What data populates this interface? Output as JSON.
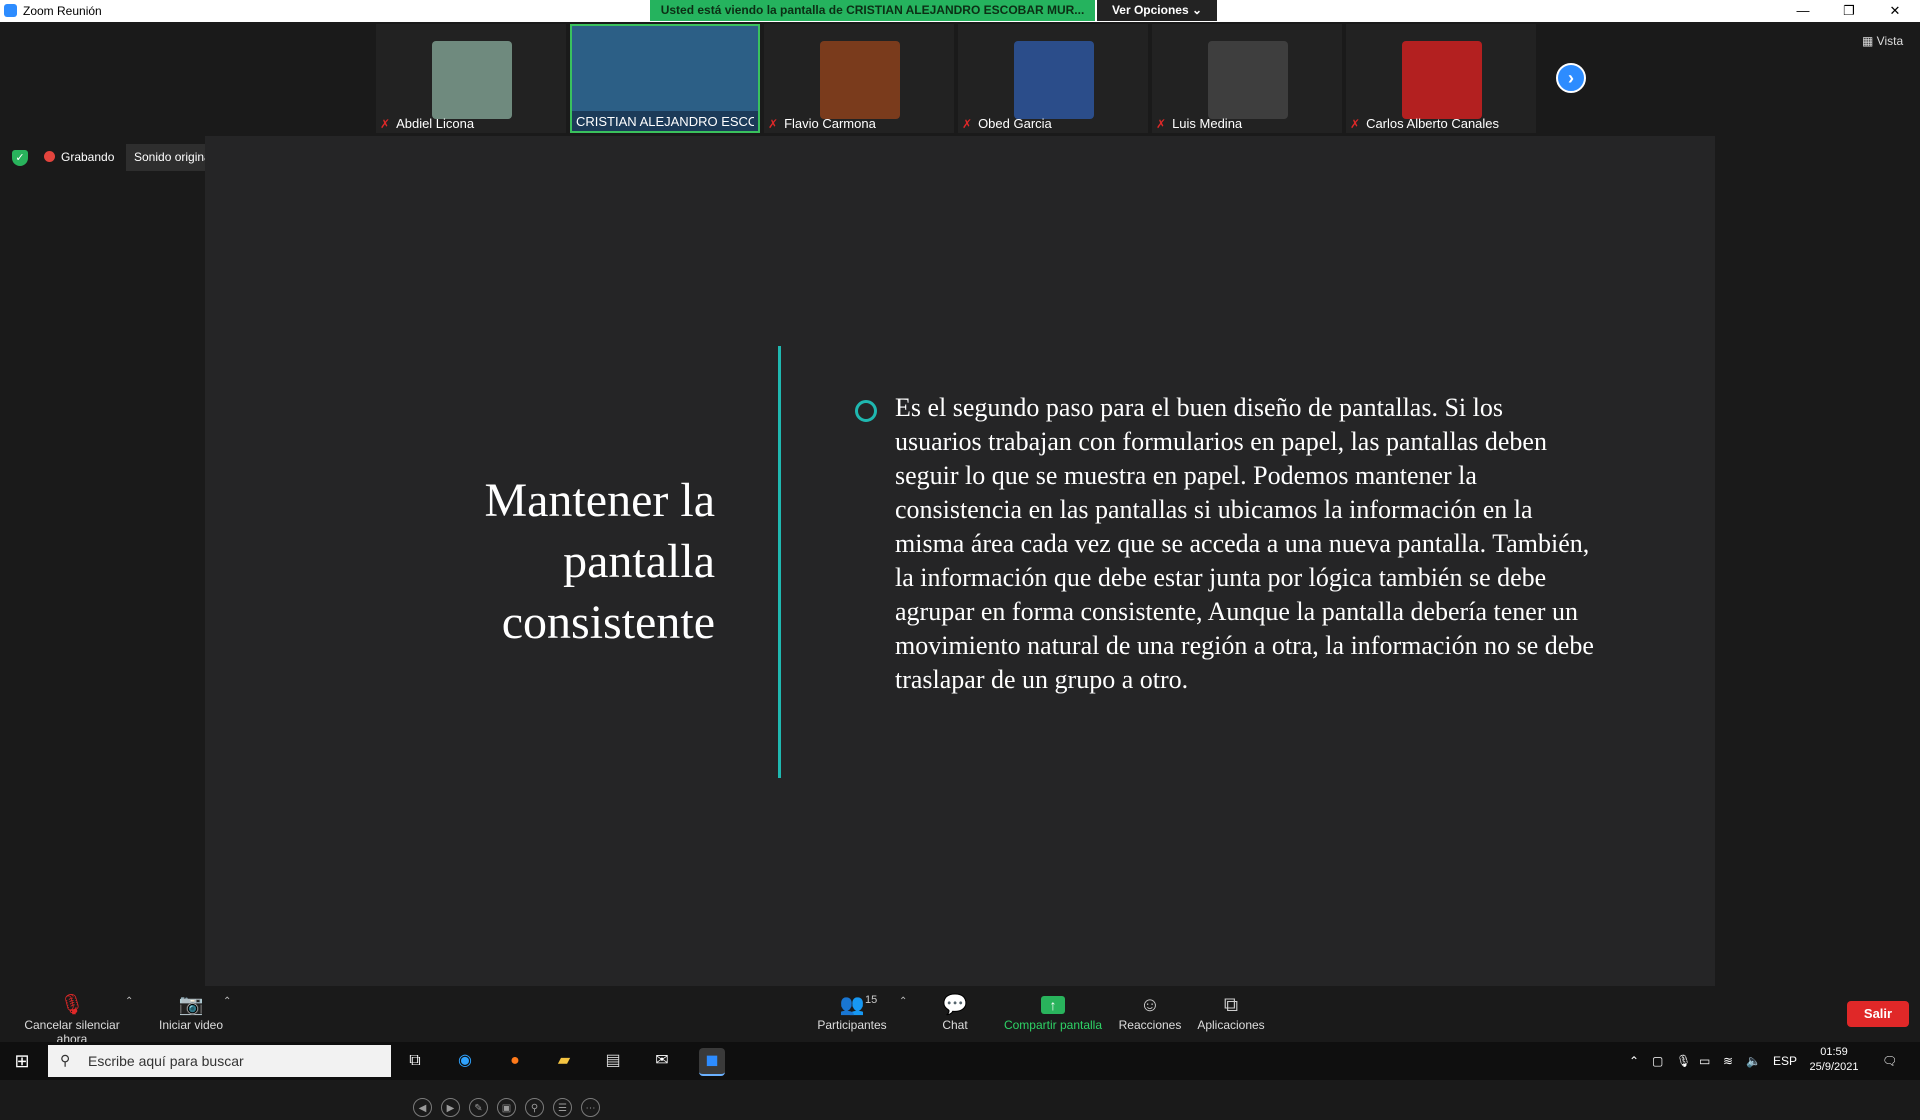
{
  "window": {
    "title": "Zoom Reunión",
    "share_banner": "Usted está viendo la pantalla de CRISTIAN ALEJANDRO ESCOBAR MUR...",
    "view_options": "Ver Opciones",
    "minimize": "—",
    "restore": "❐",
    "close": "✕"
  },
  "participants_strip": [
    {
      "name": "Abdiel Licona",
      "muted": true,
      "face_color": "#6f8a7e"
    },
    {
      "name": "CRISTIAN ALEJANDRO ESCOB...",
      "muted": false,
      "face_color": "#2c5f86",
      "active": true
    },
    {
      "name": "Flavio Carmona",
      "muted": true,
      "face_color": "#7a3b1c"
    },
    {
      "name": "Obed Garcia",
      "muted": true,
      "face_color": "#2b4d8a"
    },
    {
      "name": "Luis Medina",
      "muted": true,
      "face_color": "#3e3e3e"
    },
    {
      "name": "Carlos Alberto Canales",
      "muted": true,
      "face_color": "#b32020"
    }
  ],
  "next_arrow": "›",
  "vista_label": "Vista",
  "recording": {
    "status": "Grabando",
    "original_sound": "Sonido original: desactivado"
  },
  "slide": {
    "title": "Mantener la pantalla consistente",
    "body": "Es el segundo paso para el buen diseño de pantallas. Si los usuarios trabajan con formularios en papel, las pantallas deben seguir lo que se muestra en papel. Podemos mantener la consistencia en las pantallas si ubicamos la información en la misma área cada vez que se acceda a una nueva pantalla. También, la información que debe estar junta por lógica también se debe agrupar en forma consistente, Aunque la pantalla debería tener un movimiento natural de una región a otra, la información no se debe traslapar de un grupo a otro."
  },
  "controls": {
    "unmute": "Cancelar silenciar ahora",
    "video": "Iniciar video",
    "participants": "Participantes",
    "participants_count": "15",
    "chat": "Chat",
    "share": "Compartir pantalla",
    "reactions": "Reacciones",
    "apps": "Aplicaciones",
    "exit": "Salir"
  },
  "taskbar": {
    "search_placeholder": "Escribe aquí para buscar",
    "language": "ESP",
    "time": "01:59",
    "date": "25/9/2021"
  },
  "colors": {
    "accent_teal": "#1fb8b0",
    "zoom_blue": "#2d8cff",
    "recording_red": "#e3443d",
    "share_green": "#25b35e",
    "exit_red": "#e02828"
  }
}
